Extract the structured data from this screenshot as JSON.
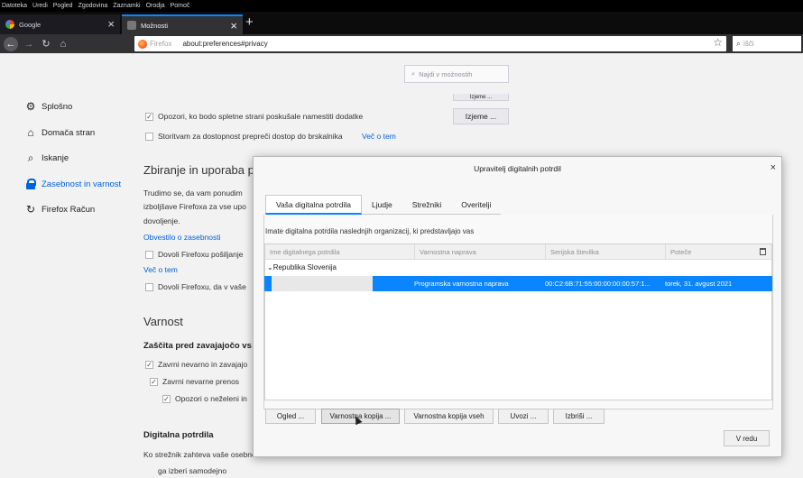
{
  "menubar": [
    "Datoteka",
    "Uredi",
    "Pogled",
    "Zgodovina",
    "Zaznamki",
    "Orodja",
    "Pomoč"
  ],
  "tabs": [
    {
      "label": "Google",
      "close": "×"
    },
    {
      "label": "Možnosti",
      "close": "×"
    }
  ],
  "newtab": "+",
  "navbar": {
    "back": "←",
    "forward": "→",
    "reload": "↻",
    "home": "⌂",
    "url_chip": "Firefox",
    "url": "about:preferences#privacy",
    "star": "☆",
    "search_placeholder": "išči",
    "search_mag": "⌕"
  },
  "page_search": {
    "mag": "⌕",
    "placeholder": "Najdi v možnostih"
  },
  "sidebar": [
    {
      "label": "Splošno",
      "icon": "⚙"
    },
    {
      "label": "Domača stran",
      "icon": "⌂"
    },
    {
      "label": "Iskanje",
      "icon": "⌕"
    },
    {
      "label": "Zasebnost in varnost",
      "icon": "lock"
    },
    {
      "label": "Firefox Račun",
      "icon": "↻"
    }
  ],
  "background": {
    "addon_warn": "Opozori, ko bodo spletne strani poskušale namestiti dodatke",
    "exceptions": "Izjeme ...",
    "partial_btn": "Izjeme ...",
    "accessibility": "Storitvam za dostopnost prepreči dostop do brskalnika",
    "learn_more": "Več o tem",
    "data_heading": "Zbiranje in uporaba p",
    "data_text1": "Trudimo se, da vam ponudim",
    "data_text2": "izboljšave Firefoxa za vse upo",
    "data_text3": "dovoljenje.",
    "privacy_link": "Obvestilo o zasebnosti",
    "allow1": "Dovoli Firefoxu pošiljanje",
    "learn_more2": "Več o tem",
    "allow2": "Dovoli Firefoxu, da v vaše",
    "security_heading": "Varnost",
    "deceptive_heading": "Zaščita pred zavajajočo vs",
    "block1": "Zavrni nevarno in zavajajo",
    "block2": "Zavrni nevarne prenos",
    "block3": "Opozori o neželeni in",
    "certs_heading": "Digitalna potrdila",
    "certs_text": "Ko strežnik zahteva vaše osebno",
    "auto_select": "ga izberi samodejno",
    "check": "✓"
  },
  "dialog": {
    "title": "Upravitelj digitalnih potrdil",
    "close": "×",
    "tabs": [
      "Vaša digitalna potrdila",
      "Ljudje",
      "Strežniki",
      "Overitelji"
    ],
    "description": "Imate digitalna potrdila naslednjih organizacij, ki predstavljajo vas",
    "columns": [
      "Ime digitalnega potrdila",
      "Varnostna naprava",
      "Serijska številka",
      "Poteče"
    ],
    "group": "Republika Slovenija",
    "group_toggle": "⌄",
    "certificate": {
      "name": "",
      "device": "Programska varnostna naprava",
      "serial": "00:C2:6B:71:55:00:00:00:00:57:1...",
      "expires": "torek, 31. avgust 2021"
    },
    "buttons": [
      "Ogled ...",
      "Varnostna kopija ...",
      "Varnostna kopija vseh",
      "Uvozi ...",
      "Izbriši ..."
    ],
    "ok": "V redu"
  },
  "colors": {
    "accent": "#0a84ff",
    "link": "#0060df",
    "chrome": "#323234"
  }
}
